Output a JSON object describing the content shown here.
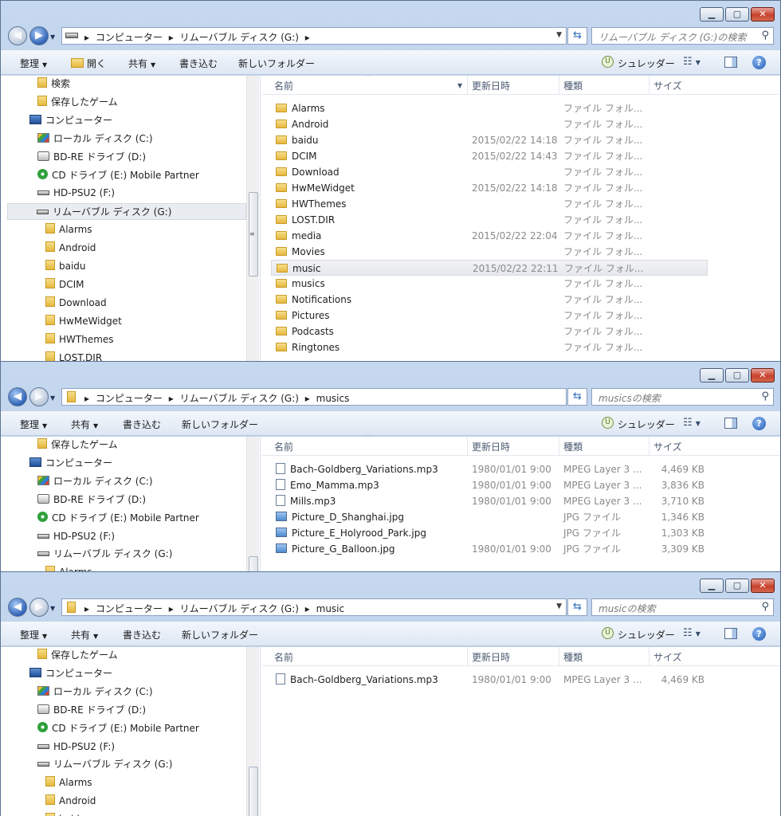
{
  "window1": {
    "breadcrumb": [
      "コンピューター",
      "リムーバブル ディスク (G:)"
    ],
    "search_placeholder": "リムーバブル ディスク (G:)の検索",
    "toolbar": {
      "organize": "整理",
      "open": "開く",
      "share": "共有",
      "burn": "書き込む",
      "new_folder": "新しいフォルダー",
      "shredder": "シュレッダー"
    },
    "tree": [
      {
        "label": "検索",
        "icon": "folder",
        "level": 2
      },
      {
        "label": "保存したゲーム",
        "icon": "folder",
        "level": 2
      },
      {
        "label": "コンピューター",
        "icon": "computer",
        "level": 1
      },
      {
        "label": "ローカル ディスク (C:)",
        "icon": "disk",
        "level": 2
      },
      {
        "label": "BD-RE ドライブ (D:)",
        "icon": "optical",
        "level": 2
      },
      {
        "label": "CD ドライブ (E:) Mobile Partner",
        "icon": "cd",
        "level": 2
      },
      {
        "label": "HD-PSU2 (F:)",
        "icon": "drive",
        "level": 2
      },
      {
        "label": "リムーバブル ディスク (G:)",
        "icon": "drive",
        "level": 2,
        "selected": true
      },
      {
        "label": "Alarms",
        "icon": "folder",
        "level": 3
      },
      {
        "label": "Android",
        "icon": "folder",
        "level": 3
      },
      {
        "label": "baidu",
        "icon": "folder",
        "level": 3
      },
      {
        "label": "DCIM",
        "icon": "folder",
        "level": 3
      },
      {
        "label": "Download",
        "icon": "folder",
        "level": 3
      },
      {
        "label": "HwMeWidget",
        "icon": "folder",
        "level": 3
      },
      {
        "label": "HWThemes",
        "icon": "folder",
        "level": 3
      },
      {
        "label": "LOST.DIR",
        "icon": "folder",
        "level": 3
      }
    ],
    "columns": {
      "name": "名前",
      "date": "更新日時",
      "type": "種類",
      "size": "サイズ"
    },
    "files": [
      {
        "name": "Alarms",
        "date": "",
        "type": "ファイル フォル...",
        "size": "",
        "kind": "folder"
      },
      {
        "name": "Android",
        "date": "",
        "type": "ファイル フォル...",
        "size": "",
        "kind": "folder"
      },
      {
        "name": "baidu",
        "date": "2015/02/22 14:18",
        "type": "ファイル フォル...",
        "size": "",
        "kind": "folder"
      },
      {
        "name": "DCIM",
        "date": "2015/02/22 14:43",
        "type": "ファイル フォル...",
        "size": "",
        "kind": "folder"
      },
      {
        "name": "Download",
        "date": "",
        "type": "ファイル フォル...",
        "size": "",
        "kind": "folder"
      },
      {
        "name": "HwMeWidget",
        "date": "2015/02/22 14:18",
        "type": "ファイル フォル...",
        "size": "",
        "kind": "folder"
      },
      {
        "name": "HWThemes",
        "date": "",
        "type": "ファイル フォル...",
        "size": "",
        "kind": "folder"
      },
      {
        "name": "LOST.DIR",
        "date": "",
        "type": "ファイル フォル...",
        "size": "",
        "kind": "folder"
      },
      {
        "name": "media",
        "date": "2015/02/22 22:04",
        "type": "ファイル フォル...",
        "size": "",
        "kind": "folder"
      },
      {
        "name": "Movies",
        "date": "",
        "type": "ファイル フォル...",
        "size": "",
        "kind": "folder"
      },
      {
        "name": "music",
        "date": "2015/02/22 22:11",
        "type": "ファイル フォル...",
        "size": "",
        "kind": "folder",
        "selected": true
      },
      {
        "name": "musics",
        "date": "",
        "type": "ファイル フォル...",
        "size": "",
        "kind": "folder"
      },
      {
        "name": "Notifications",
        "date": "",
        "type": "ファイル フォル...",
        "size": "",
        "kind": "folder"
      },
      {
        "name": "Pictures",
        "date": "",
        "type": "ファイル フォル...",
        "size": "",
        "kind": "folder"
      },
      {
        "name": "Podcasts",
        "date": "",
        "type": "ファイル フォル...",
        "size": "",
        "kind": "folder"
      },
      {
        "name": "Ringtones",
        "date": "",
        "type": "ファイル フォル...",
        "size": "",
        "kind": "folder"
      }
    ]
  },
  "window2": {
    "breadcrumb": [
      "コンピューター",
      "リムーバブル ディスク (G:)",
      "musics"
    ],
    "search_placeholder": "musicsの検索",
    "toolbar": {
      "organize": "整理",
      "share": "共有",
      "burn": "書き込む",
      "new_folder": "新しいフォルダー",
      "shredder": "シュレッダー"
    },
    "tree": [
      {
        "label": "保存したゲーム",
        "icon": "folder",
        "level": 2
      },
      {
        "label": "コンピューター",
        "icon": "computer",
        "level": 1
      },
      {
        "label": "ローカル ディスク (C:)",
        "icon": "disk",
        "level": 2
      },
      {
        "label": "BD-RE ドライブ (D:)",
        "icon": "optical",
        "level": 2
      },
      {
        "label": "CD ドライブ (E:) Mobile Partner",
        "icon": "cd",
        "level": 2
      },
      {
        "label": "HD-PSU2 (F:)",
        "icon": "drive",
        "level": 2
      },
      {
        "label": "リムーバブル ディスク (G:)",
        "icon": "drive",
        "level": 2
      },
      {
        "label": "Alarms",
        "icon": "folder",
        "level": 3
      }
    ],
    "columns": {
      "name": "名前",
      "date": "更新日時",
      "type": "種類",
      "size": "サイズ"
    },
    "files": [
      {
        "name": "Bach-Goldberg_Variations.mp3",
        "date": "1980/01/01 9:00",
        "type": "MPEG Layer 3 ...",
        "size": "4,469 KB",
        "kind": "audio"
      },
      {
        "name": "Emo_Mamma.mp3",
        "date": "1980/01/01 9:00",
        "type": "MPEG Layer 3 ...",
        "size": "3,836 KB",
        "kind": "audio"
      },
      {
        "name": "Mills.mp3",
        "date": "1980/01/01 9:00",
        "type": "MPEG Layer 3 ...",
        "size": "3,710 KB",
        "kind": "audio"
      },
      {
        "name": "Picture_D_Shanghai.jpg",
        "date": "",
        "type": "JPG ファイル",
        "size": "1,346 KB",
        "kind": "image"
      },
      {
        "name": "Picture_E_Holyrood_Park.jpg",
        "date": "",
        "type": "JPG ファイル",
        "size": "1,303 KB",
        "kind": "image"
      },
      {
        "name": "Picture_G_Balloon.jpg",
        "date": "1980/01/01 9:00",
        "type": "JPG ファイル",
        "size": "3,309 KB",
        "kind": "image"
      }
    ]
  },
  "window3": {
    "breadcrumb": [
      "コンピューター",
      "リムーバブル ディスク (G:)",
      "music"
    ],
    "search_placeholder": "musicの検索",
    "toolbar": {
      "organize": "整理",
      "share": "共有",
      "burn": "書き込む",
      "new_folder": "新しいフォルダー",
      "shredder": "シュレッダー"
    },
    "tree": [
      {
        "label": "保存したゲーム",
        "icon": "folder",
        "level": 2
      },
      {
        "label": "コンピューター",
        "icon": "computer",
        "level": 1
      },
      {
        "label": "ローカル ディスク (C:)",
        "icon": "disk",
        "level": 2
      },
      {
        "label": "BD-RE ドライブ (D:)",
        "icon": "optical",
        "level": 2
      },
      {
        "label": "CD ドライブ (E:) Mobile Partner",
        "icon": "cd",
        "level": 2
      },
      {
        "label": "HD-PSU2 (F:)",
        "icon": "drive",
        "level": 2
      },
      {
        "label": "リムーバブル ディスク (G:)",
        "icon": "drive",
        "level": 2
      },
      {
        "label": "Alarms",
        "icon": "folder",
        "level": 3
      },
      {
        "label": "Android",
        "icon": "folder",
        "level": 3
      },
      {
        "label": "baidu",
        "icon": "folder",
        "level": 3
      }
    ],
    "columns": {
      "name": "名前",
      "date": "更新日時",
      "type": "種類",
      "size": "サイズ"
    },
    "files": [
      {
        "name": "Bach-Goldberg_Variations.mp3",
        "date": "1980/01/01 9:00",
        "type": "MPEG Layer 3 ...",
        "size": "4,469 KB",
        "kind": "audio"
      }
    ]
  }
}
